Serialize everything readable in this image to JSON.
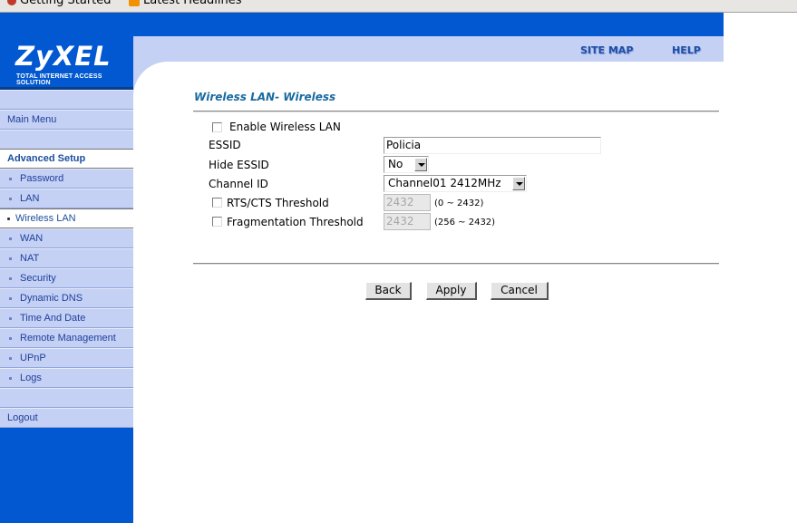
{
  "browser": {
    "bookmarks": [
      "Getting Started",
      "Latest Headlines"
    ]
  },
  "brand": {
    "logo": "ZyXEL",
    "tagline": "Total Internet Access Solution"
  },
  "header": {
    "links": {
      "site_map": "SITE MAP",
      "help": "HELP"
    }
  },
  "sidebar": {
    "main_menu": "Main Menu",
    "section": "Advanced Setup",
    "items": [
      {
        "label": "Password",
        "active": false
      },
      {
        "label": "LAN",
        "active": false
      },
      {
        "label": "Wireless LAN",
        "active": true
      },
      {
        "label": "WAN",
        "active": false
      },
      {
        "label": "NAT",
        "active": false
      },
      {
        "label": "Security",
        "active": false
      },
      {
        "label": "Dynamic DNS",
        "active": false
      },
      {
        "label": "Time And Date",
        "active": false
      },
      {
        "label": "Remote Management",
        "active": false
      },
      {
        "label": "UPnP",
        "active": false
      },
      {
        "label": "Logs",
        "active": false
      }
    ],
    "logout": "Logout"
  },
  "form": {
    "title": "Wireless LAN- Wireless",
    "enable_wireless": {
      "label": "Enable Wireless LAN",
      "checked": false
    },
    "essid": {
      "label": "ESSID",
      "value": "Policia"
    },
    "hide_essid": {
      "label": "Hide ESSID",
      "value": "No"
    },
    "channel": {
      "label": "Channel ID",
      "value": "Channel01 2412MHz"
    },
    "rts": {
      "label": "RTS/CTS Threshold",
      "checked": false,
      "value": "2432",
      "range": "(0 ~ 2432)"
    },
    "frag": {
      "label": "Fragmentation Threshold",
      "checked": false,
      "value": "2432",
      "range": "(256 ~ 2432)"
    }
  },
  "buttons": {
    "back": "Back",
    "apply": "Apply",
    "cancel": "Cancel"
  },
  "colors": {
    "sidebar_blue": "#0158d1",
    "menu_bg": "#c4d0f4",
    "title": "#1a6aa0"
  }
}
